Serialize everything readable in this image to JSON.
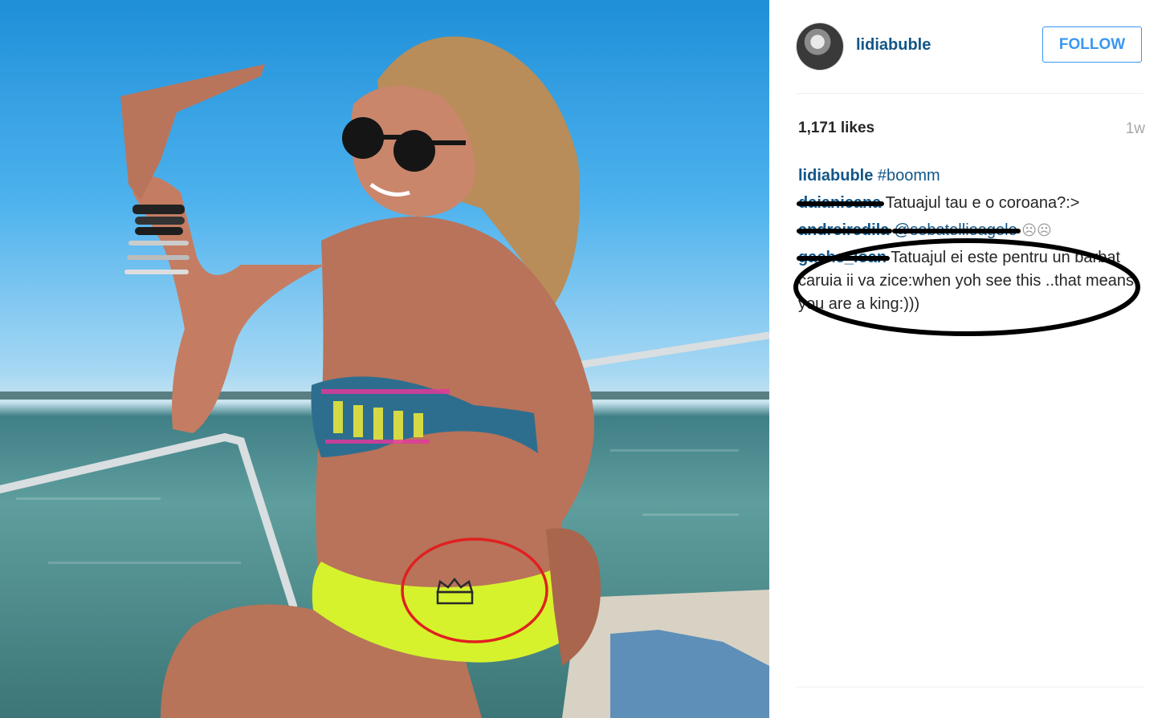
{
  "post": {
    "photo_alt": "photo",
    "author": {
      "username": "lidiabuble",
      "follow_label": "FOLLOW"
    },
    "likes": "1,171 likes",
    "age": "1w",
    "caption": {
      "user": "lidiabuble",
      "text": "#boomm"
    },
    "comments": [
      {
        "user": "daianicana",
        "text": "Tatuajul tau e o coroana?:>"
      },
      {
        "user": "andreiredila",
        "text": "@sebatellioagelo",
        "emoji": "☹☹"
      },
      {
        "user": "gache_ioan",
        "text": "Tatuajul ei este pentru un barbat caruia ii va zice:when yoh see this ..that means you are a king:)))"
      }
    ]
  },
  "annotations": {
    "red_circle_color": "#e02020",
    "black_ellipse_color": "#000000"
  }
}
